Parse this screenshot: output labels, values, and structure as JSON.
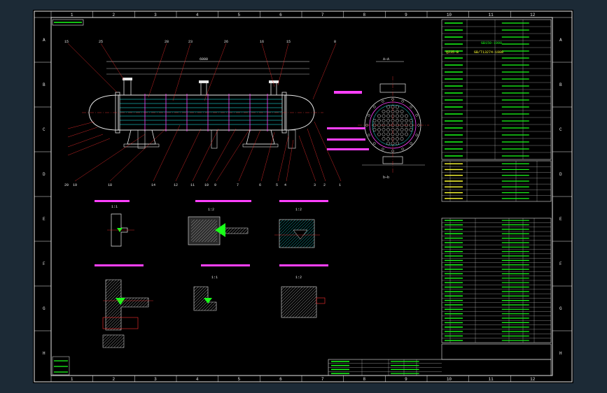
{
  "sheet": {
    "columns_top": [
      "1",
      "2",
      "3",
      "4",
      "5",
      "6",
      "7",
      "8",
      "9",
      "10",
      "11",
      "12"
    ],
    "columns_bottom": [
      "1",
      "2",
      "3",
      "4",
      "5",
      "6",
      "7",
      "8",
      "9",
      "10",
      "11",
      "12"
    ],
    "rows_left": [
      "A",
      "B",
      "C",
      "D",
      "E",
      "F",
      "G",
      "H"
    ],
    "rows_right": [
      "A",
      "B",
      "C",
      "D",
      "E",
      "F",
      "G",
      "H"
    ]
  },
  "views": {
    "main_length_dim": "6000",
    "section_title": "A—A",
    "section_sub": "b—b",
    "detail_titles": [
      "1:1",
      "1:2",
      "1:2",
      "1:1",
      "1:2"
    ],
    "balloons_top": [
      "15",
      "25",
      "28",
      "23",
      "26",
      "16",
      "15",
      "8"
    ],
    "balloons_bottom": [
      "20",
      "19",
      "18",
      "14",
      "12",
      "11",
      "10",
      "9",
      "7",
      "6",
      "5",
      "4",
      "3",
      "2",
      "1"
    ]
  },
  "title_block": {
    "standard": "GB150-1998",
    "material": "Q235-B",
    "standard2": "GB/T13274-1988"
  },
  "colors": {
    "sheet_bg": "#000000",
    "frame": "#e8e8e8",
    "green": "#19ff19",
    "magenta": "#ff40ff",
    "yellow": "#ffff33",
    "red": "#ff3030",
    "cyan": "#20ffff",
    "outer_bg": "#1c2a36"
  }
}
